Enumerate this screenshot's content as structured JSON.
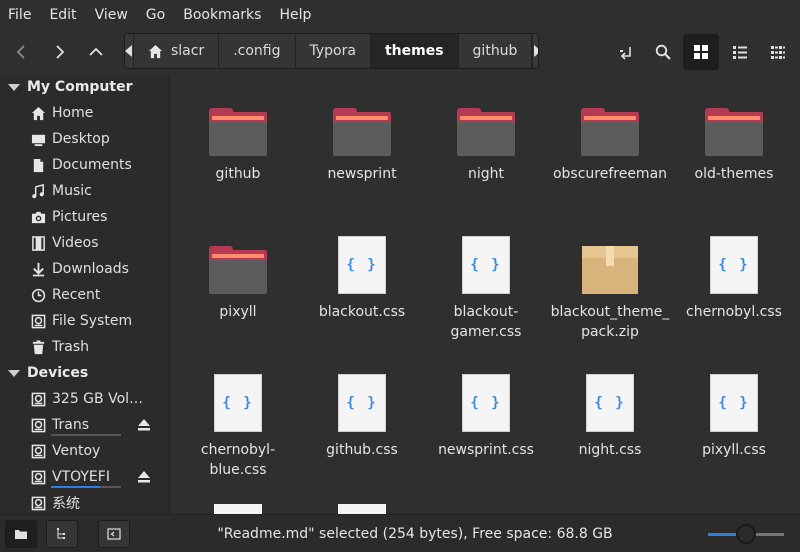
{
  "menubar": [
    "File",
    "Edit",
    "View",
    "Go",
    "Bookmarks",
    "Help"
  ],
  "breadcrumb": [
    "slacr",
    ".config",
    "Typora",
    "themes",
    "github"
  ],
  "breadcrumb_active_index": 3,
  "sidebar": {
    "my_computer": {
      "title": "My Computer",
      "items": [
        {
          "label": "Home",
          "icon": "home-icon"
        },
        {
          "label": "Desktop",
          "icon": "desktop-icon"
        },
        {
          "label": "Documents",
          "icon": "document-icon"
        },
        {
          "label": "Music",
          "icon": "music-icon"
        },
        {
          "label": "Pictures",
          "icon": "camera-icon"
        },
        {
          "label": "Videos",
          "icon": "film-icon"
        },
        {
          "label": "Downloads",
          "icon": "download-icon"
        },
        {
          "label": "Recent",
          "icon": "clock-icon"
        },
        {
          "label": "File System",
          "icon": "drive-icon"
        },
        {
          "label": "Trash",
          "icon": "trash-icon"
        }
      ]
    },
    "devices": {
      "title": "Devices",
      "items": [
        {
          "label": "325 GB Vol…",
          "icon": "drive-icon"
        },
        {
          "label": "Trans",
          "icon": "drive-icon",
          "eject": true
        },
        {
          "label": "Ventoy",
          "icon": "drive-icon"
        },
        {
          "label": "VTOYEFI",
          "icon": "drive-icon",
          "eject": true
        },
        {
          "label": "系统",
          "icon": "drive-icon"
        }
      ]
    }
  },
  "files": [
    {
      "name": "github",
      "type": "folder"
    },
    {
      "name": "newsprint",
      "type": "folder"
    },
    {
      "name": "night",
      "type": "folder"
    },
    {
      "name": "obscurefreeman",
      "type": "folder"
    },
    {
      "name": "old-themes",
      "type": "folder"
    },
    {
      "name": "pixyll",
      "type": "folder"
    },
    {
      "name": "blackout.css",
      "type": "css"
    },
    {
      "name": "blackout-gamer.css",
      "type": "css"
    },
    {
      "name": "blackout_theme_pack.zip",
      "type": "zip"
    },
    {
      "name": "chernobyl.css",
      "type": "css"
    },
    {
      "name": "chernobyl-blue.css",
      "type": "css"
    },
    {
      "name": "github.css",
      "type": "css"
    },
    {
      "name": "newsprint.css",
      "type": "css"
    },
    {
      "name": "night.css",
      "type": "css"
    },
    {
      "name": "pixyll.css",
      "type": "css"
    }
  ],
  "css_icon_glyph": "{ }",
  "status": {
    "text": "\"Readme.md\" selected (254 bytes), Free space: 68.8 GB",
    "zoom_fraction": 0.5
  },
  "colors": {
    "accent": "#2f7de0",
    "folder_tab": "#b73a55",
    "folder_stripe": "#ff8f6b",
    "background": "#2f2f2f"
  }
}
